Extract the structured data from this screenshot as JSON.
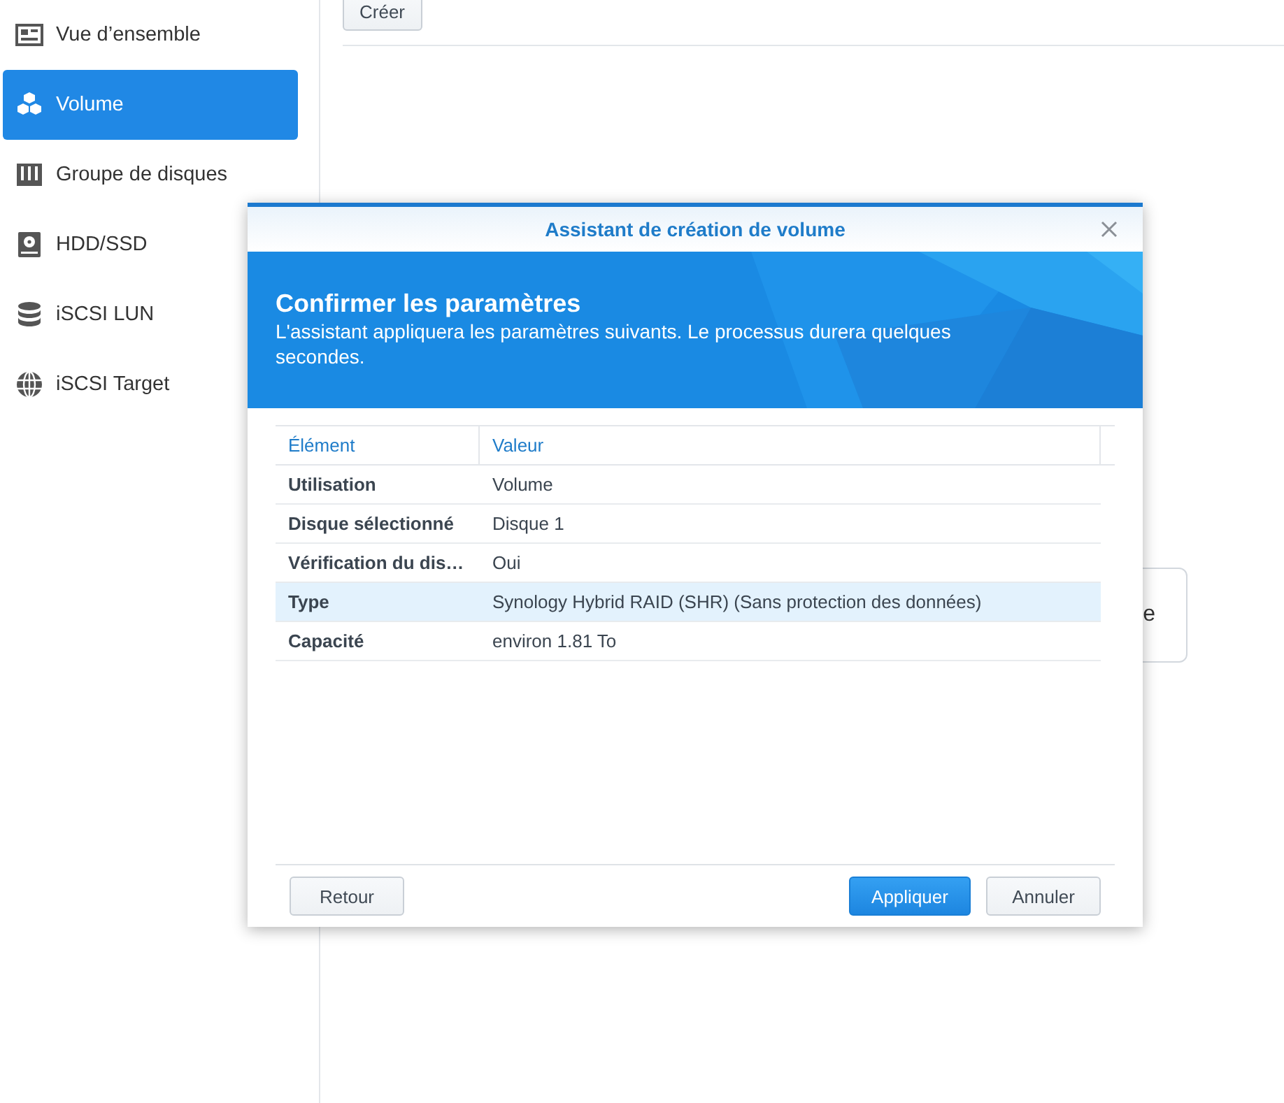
{
  "sidebar": {
    "items": [
      {
        "label": "Vue d’ensemble",
        "selected": false
      },
      {
        "label": "Volume",
        "selected": true
      },
      {
        "label": "Groupe de disques",
        "selected": false
      },
      {
        "label": "HDD/SSD",
        "selected": false
      },
      {
        "label": "iSCSI LUN",
        "selected": false
      },
      {
        "label": "iSCSI Target",
        "selected": false
      }
    ]
  },
  "toolbar": {
    "buttons": [
      "Créer"
    ]
  },
  "background_card": {
    "text": "e"
  },
  "dialog": {
    "title": "Assistant de création de volume",
    "banner": {
      "heading": "Confirmer les paramètres",
      "text": "L'assistant appliquera les paramètres suivants. Le processus durera quelques secondes."
    },
    "table": {
      "columns": [
        "Élément",
        "Valeur"
      ],
      "rows": [
        {
          "item": "Utilisation",
          "value": "Volume",
          "selected": false
        },
        {
          "item": "Disque sélectionné",
          "value": "Disque 1",
          "selected": false
        },
        {
          "item": "Vérification du dis…",
          "value": "Oui",
          "selected": false
        },
        {
          "item": "Type",
          "value": "Synology Hybrid RAID (SHR) (Sans protection des données)",
          "selected": true
        },
        {
          "item": "Capacité",
          "value": "environ 1.81 To",
          "selected": false
        }
      ]
    },
    "footer": {
      "left_buttons": [
        "Retour"
      ],
      "right_buttons": [
        {
          "label": "Appliquer",
          "kind": "primary"
        },
        {
          "label": "Annuler",
          "kind": "secondary"
        }
      ]
    }
  }
}
